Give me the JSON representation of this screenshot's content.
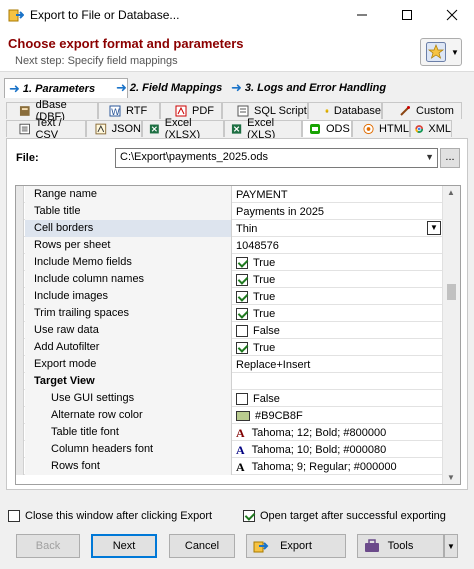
{
  "window": {
    "title": "Export to File or Database..."
  },
  "header": {
    "title": "Choose export format and parameters",
    "subtitle": "Next step: Specify field mappings"
  },
  "steps": [
    {
      "label": "1. Parameters",
      "active": true
    },
    {
      "label": "2. Field Mappings",
      "active": false
    },
    {
      "label": "3. Logs and Error Handling",
      "active": false
    }
  ],
  "format_tabs_row1": [
    {
      "label": "dBase (DBF)",
      "icon": "dbase-icon"
    },
    {
      "label": "RTF",
      "icon": "word-icon"
    },
    {
      "label": "PDF",
      "icon": "pdf-icon"
    },
    {
      "label": "SQL Script",
      "icon": "sql-script-icon"
    },
    {
      "label": "Database",
      "icon": "database-icon"
    },
    {
      "label": "Custom",
      "icon": "brush-icon"
    }
  ],
  "format_tabs_row2": [
    {
      "label": "Text / CSV",
      "icon": "text-file-icon"
    },
    {
      "label": "JSON",
      "icon": "json-icon"
    },
    {
      "label": "Excel (XLSX)",
      "icon": "excel-icon"
    },
    {
      "label": "Excel (XLS)",
      "icon": "excel-icon"
    },
    {
      "label": "ODS",
      "icon": "ods-icon",
      "selected": true
    },
    {
      "label": "HTML",
      "icon": "html-icon"
    },
    {
      "label": "XML",
      "icon": "chrome-icon"
    }
  ],
  "file": {
    "label": "File:",
    "value": "C:\\Export\\payments_2025.ods",
    "browse_label": "..."
  },
  "properties": [
    {
      "name": "Range name",
      "value": "PAYMENT",
      "kind": "text"
    },
    {
      "name": "Table title",
      "value": "Payments in 2025",
      "kind": "text"
    },
    {
      "name": "Cell borders",
      "value": "Thin",
      "kind": "combo",
      "selected": true
    },
    {
      "name": "Rows per sheet",
      "value": "1048576",
      "kind": "text"
    },
    {
      "name": "Include Memo fields",
      "value": "True",
      "kind": "check",
      "checked": true
    },
    {
      "name": "Include column names",
      "value": "True",
      "kind": "check",
      "checked": true
    },
    {
      "name": "Include images",
      "value": "True",
      "kind": "check",
      "checked": true
    },
    {
      "name": "Trim trailing spaces",
      "value": "True",
      "kind": "check",
      "checked": true
    },
    {
      "name": "Use raw data",
      "value": "False",
      "kind": "check",
      "checked": false
    },
    {
      "name": "Add Autofilter",
      "value": "True",
      "kind": "check",
      "checked": true
    },
    {
      "name": "Export mode",
      "value": "Replace+Insert",
      "kind": "text"
    },
    {
      "name": "Target View",
      "value": "",
      "kind": "category"
    },
    {
      "name": "Use GUI settings",
      "value": "False",
      "kind": "check",
      "checked": false,
      "indent": true
    },
    {
      "name": "Alternate row color",
      "value": "#B9CB8F",
      "kind": "color",
      "color": "#B9CB8F",
      "indent": true
    },
    {
      "name": "Table title font",
      "value": "Tahoma; 12; Bold; #800000",
      "kind": "font",
      "color": "#800000",
      "indent": true
    },
    {
      "name": "Column headers font",
      "value": "Tahoma; 10; Bold; #000080",
      "kind": "font",
      "color": "#000080",
      "indent": true
    },
    {
      "name": "Rows font",
      "value": "Tahoma; 9; Regular; #000000",
      "kind": "font",
      "color": "#000000",
      "indent": true
    }
  ],
  "options": {
    "close_window": {
      "label": "Close this window after clicking Export",
      "checked": false
    },
    "open_target": {
      "label": "Open target after successful exporting",
      "checked": true
    }
  },
  "buttons": {
    "back": "Back",
    "next": "Next",
    "cancel": "Cancel",
    "export": "Export",
    "tools": "Tools"
  }
}
